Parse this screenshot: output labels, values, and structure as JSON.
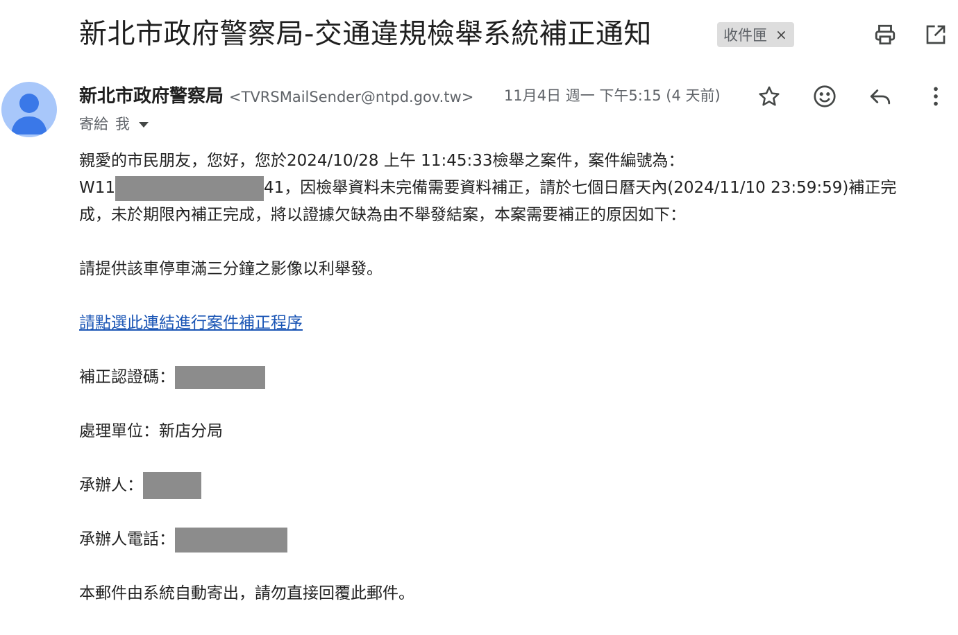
{
  "email": {
    "subject": "新北市政府警察局-交通違規檢舉系統補正通知",
    "label": "收件匣",
    "label_remove": "×",
    "sender_name": "新北市政府警察局",
    "sender_email": "<TVRSMailSender@ntpd.gov.tw>",
    "date": "11月4日 週一 下午5:15 (4 天前)",
    "to_prefix": "寄給",
    "to_name": "我"
  },
  "icons": {
    "print": "printer-icon",
    "open_new_window": "open-in-new-window-icon",
    "star": "star-icon",
    "emoji": "emoji-smile-icon",
    "reply": "reply-icon",
    "more": "more-vertical-icon",
    "avatar": "person-avatar-icon",
    "caret": "caret-down-icon"
  },
  "body": {
    "line1": "親愛的市民朋友，您好，您於2024/10/28 上午 11:45:33檢舉之案件，案件編號為：",
    "case_prefix": "W11",
    "case_suffix": "41，因檢舉資料未完備需要資料補正，請於七個日曆天內(2024/11/10 23:59:59)補正完",
    "line3": "成，未於期限內補正完成，將以證據欠缺為由不舉發結案，本案需要補正的原因如下：",
    "reason": "請提供該車停車滿三分鐘之影像以利舉發。",
    "link_text": "請點選此連結進行案件補正程序",
    "auth_code_label": "補正認證碼：",
    "unit_label": "處理單位：",
    "unit_value": "新店分局",
    "handler_label": "承辦人：",
    "handler_phone_label": "承辦人電話：",
    "footer": "本郵件由系統自動寄出，請勿直接回覆此郵件。"
  },
  "colors": {
    "link": "#1a55b5",
    "avatar_bg": "#a8c7fa",
    "avatar_fg": "#3a78e8",
    "redaction": "#8c8c8c",
    "label_chip_bg": "#dddddd"
  }
}
